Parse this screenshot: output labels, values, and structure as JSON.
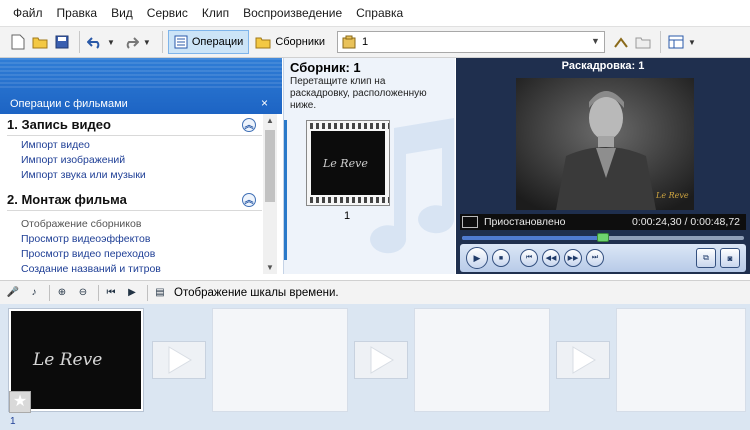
{
  "menu": [
    "Файл",
    "Правка",
    "Вид",
    "Сервис",
    "Клип",
    "Воспроизведение",
    "Справка"
  ],
  "toolbar": {
    "operations_label": "Операции",
    "collections_label": "Сборники",
    "collection_combo_value": "1"
  },
  "taskpane": {
    "title": "Операции с фильмами",
    "close_glyph": "×",
    "sections": [
      {
        "title": "1. Запись видео",
        "links": [
          "Импорт видео",
          "Импорт изображений",
          "Импорт звука или музыки"
        ]
      },
      {
        "title": "2. Монтаж фильма",
        "links": [
          "Отображение сборников",
          "Просмотр видеоэффектов",
          "Просмотр видео переходов",
          "Создание названий и титров"
        ]
      }
    ]
  },
  "collection": {
    "title": "Сборник: 1",
    "description": "Перетащите клип на раскадровку, расположенную ниже.",
    "clip_number": "1"
  },
  "monitor": {
    "title": "Раскадровка: 1",
    "status": "Приостановлено",
    "time": "0:00:24,30 / 0:00:48,72",
    "progress": 0.5,
    "watermark": "Le Reve"
  },
  "storyboard": {
    "toolbar_label": "Отображение шкалы времени.",
    "clip_index": "1"
  },
  "colors": {
    "taskpane_header": "#2f7dd6",
    "monitor_bg": "#1f2f4e",
    "link": "#1f3f96",
    "storyboard_bg": "#dbe6f2"
  }
}
